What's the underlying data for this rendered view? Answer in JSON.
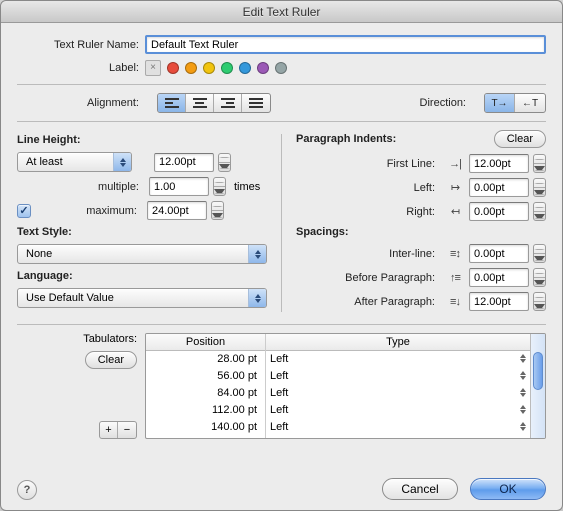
{
  "window": {
    "title": "Edit Text Ruler"
  },
  "header": {
    "name_label": "Text Ruler Name:",
    "name_value": "Default Text Ruler",
    "label_label": "Label:",
    "colors": [
      "#e74c3c",
      "#f39c12",
      "#f1c40f",
      "#2ecc71",
      "#3498db",
      "#9b59b6",
      "#95a5a6"
    ]
  },
  "alignment": {
    "label": "Alignment:"
  },
  "direction": {
    "label": "Direction:",
    "ltr": "T→",
    "rtl": "←T"
  },
  "line_height": {
    "title": "Line Height:",
    "mode": "At least",
    "value": "12.00pt",
    "multiple_label": "multiple:",
    "multiple_value": "1.00",
    "times_label": "times",
    "max_label": "maximum:",
    "max_value": "24.00pt",
    "max_checked": true
  },
  "text_style": {
    "title": "Text Style:",
    "value": "None"
  },
  "language": {
    "title": "Language:",
    "value": "Use Default Value"
  },
  "indents": {
    "title": "Paragraph Indents:",
    "clear": "Clear",
    "first_line_label": "First Line:",
    "first_line_value": "12.00pt",
    "left_label": "Left:",
    "left_value": "0.00pt",
    "right_label": "Right:",
    "right_value": "0.00pt"
  },
  "spacings": {
    "title": "Spacings:",
    "inter_label": "Inter-line:",
    "inter_value": "0.00pt",
    "before_label": "Before Paragraph:",
    "before_value": "0.00pt",
    "after_label": "After Paragraph:",
    "after_value": "12.00pt"
  },
  "tabulators": {
    "label": "Tabulators:",
    "clear": "Clear",
    "pos_header": "Position",
    "type_header": "Type",
    "rows": [
      {
        "pos": "28.00 pt",
        "type": "Left"
      },
      {
        "pos": "56.00 pt",
        "type": "Left"
      },
      {
        "pos": "84.00 pt",
        "type": "Left"
      },
      {
        "pos": "112.00 pt",
        "type": "Left"
      },
      {
        "pos": "140.00 pt",
        "type": "Left"
      }
    ]
  },
  "footer": {
    "cancel": "Cancel",
    "ok": "OK"
  }
}
